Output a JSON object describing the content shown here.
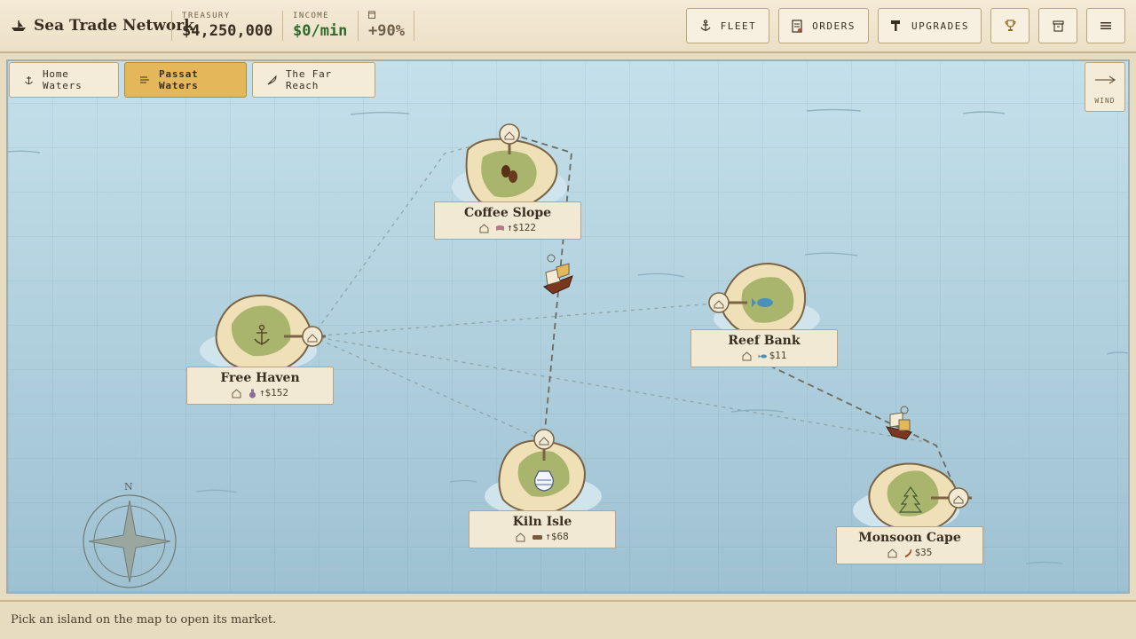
{
  "app": {
    "title": "Sea Trade Network"
  },
  "stats": {
    "treasury_label": "TREASURY",
    "treasury_value": "$4,250,000",
    "income_label": "INCOME",
    "income_value": "$0/min",
    "bonus_value": "+90%"
  },
  "toolbar": {
    "fleet_label": "FLEET",
    "orders_label": "ORDERS",
    "upgrades_label": "UPGRADES"
  },
  "regions": [
    {
      "label": "Home Waters",
      "icon": "anchor-icon",
      "active": false
    },
    {
      "label": "Passat Waters",
      "icon": "wind-icon",
      "active": true
    },
    {
      "label": "The Far Reach",
      "icon": "feather-icon",
      "active": false
    }
  ],
  "wind": {
    "label": "WIND"
  },
  "islands": [
    {
      "name": "Coffee Slope",
      "cargo_icon": "flag-icon",
      "price": "↑$122"
    },
    {
      "name": "Reef Bank",
      "cargo_icon": "fish-icon",
      "price": "$11"
    },
    {
      "name": "Free Haven",
      "cargo_icon": "potion-icon",
      "price": "↑$152"
    },
    {
      "name": "Kiln Isle",
      "cargo_icon": "brick-icon",
      "price": "↑$68"
    },
    {
      "name": "Monsoon Cape",
      "cargo_icon": "pepper-icon",
      "price": "$35"
    }
  ],
  "compass": {
    "north_label": "N"
  },
  "footer": {
    "hint": "Pick an island on the map to open its market."
  },
  "colors": {
    "sea": "#b3d3e0",
    "land": "#f0e0b8",
    "grass": "#a9b56c",
    "accent": "#e4b85a",
    "ink": "#3a2e20"
  }
}
